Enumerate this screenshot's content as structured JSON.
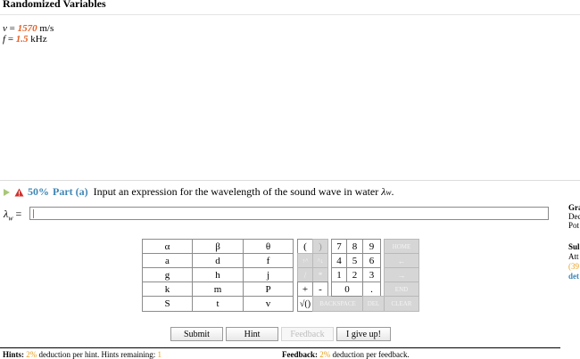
{
  "randomized": {
    "title": "Randomized Variables",
    "v_symbol": "v",
    "v_value": "1570",
    "v_unit": "m/s",
    "f_symbol": "f",
    "f_value": "1.5",
    "f_unit": "kHz"
  },
  "part": {
    "percent": "50%",
    "label": "Part (a)",
    "prompt": "Input an expression for the wavelength of the sound wave in water",
    "symbol": "λ",
    "subscript": "w",
    "period": "."
  },
  "answer": {
    "label": "λ",
    "label_sub": "w",
    "equals": "=",
    "value": ""
  },
  "side": {
    "line1": "Gra",
    "line2": "Dec",
    "line3": "Pot",
    "line4": "Sul",
    "line5": "Att",
    "line6": "(39",
    "line7": "det"
  },
  "keypad": {
    "greek": [
      "α",
      "β",
      "θ"
    ],
    "letters": [
      [
        "a",
        "d",
        "f"
      ],
      [
        "g",
        "h",
        "j"
      ],
      [
        "k",
        "m",
        "P"
      ],
      [
        "S",
        "t",
        "v"
      ]
    ],
    "ops": [
      "(",
      ")",
      "↑^",
      "^↓",
      "/",
      "*",
      "+",
      "-",
      "√()",
      "BACKSPACE"
    ],
    "digits": [
      [
        "7",
        "8",
        "9"
      ],
      [
        "4",
        "5",
        "6"
      ],
      [
        "1",
        "2",
        "3"
      ],
      [
        "0",
        "."
      ]
    ],
    "controls": [
      "HOME",
      "←",
      "→",
      "END",
      "DEL",
      "CLEAR"
    ]
  },
  "buttons": {
    "submit": "Submit",
    "hint": "Hint",
    "feedback": "Feedback",
    "give_up": "I give up!"
  },
  "footer": {
    "hints_label": "Hints:",
    "hints_pct": "2%",
    "hints_text": "deduction per hint. Hints remaining:",
    "hints_remaining": "1",
    "feedback_label": "Feedback:",
    "feedback_pct": "2%",
    "feedback_text": "deduction per feedback."
  },
  "colors": {
    "accent_blue": "#3f86b5",
    "value_orange": "#e85d22",
    "pct_orange": "#e8a020",
    "warn_red": "#d0312d"
  }
}
